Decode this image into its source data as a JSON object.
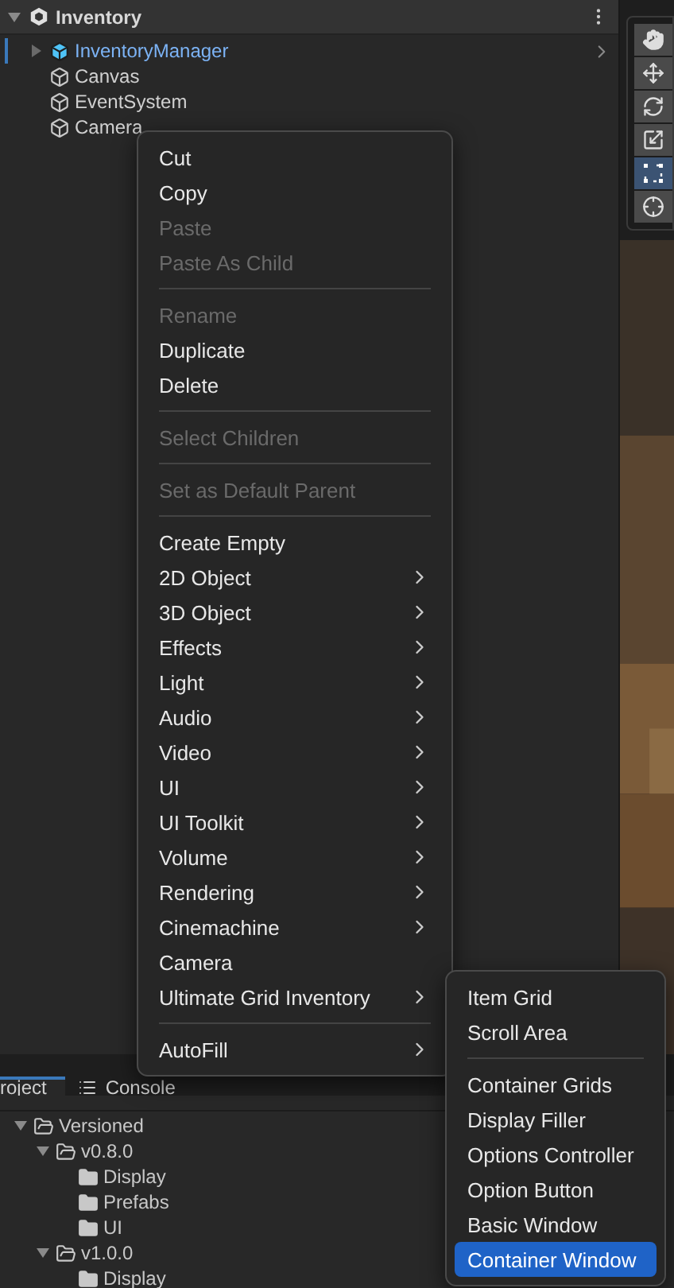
{
  "hierarchy": {
    "scene": "Inventory",
    "items": [
      {
        "label": "InventoryManager",
        "kind": "prefab",
        "selected": true,
        "expanded": false
      },
      {
        "label": "Canvas",
        "kind": "object",
        "selected": false
      },
      {
        "label": "EventSystem",
        "kind": "object",
        "selected": false
      },
      {
        "label": "Camera",
        "kind": "object",
        "selected": false
      }
    ]
  },
  "scene_tools": [
    {
      "kind": "hand",
      "selected": false
    },
    {
      "kind": "move",
      "selected": false
    },
    {
      "kind": "rotate",
      "selected": false
    },
    {
      "kind": "scale",
      "selected": false
    },
    {
      "kind": "rect",
      "selected": true
    },
    {
      "kind": "transform",
      "selected": false
    }
  ],
  "context_menu": {
    "items": [
      {
        "kind": "item",
        "label": "Cut",
        "disabled": false
      },
      {
        "kind": "item",
        "label": "Copy",
        "disabled": false
      },
      {
        "kind": "item",
        "label": "Paste",
        "disabled": true
      },
      {
        "kind": "item",
        "label": "Paste As Child",
        "disabled": true
      },
      {
        "kind": "separator"
      },
      {
        "kind": "item",
        "label": "Rename",
        "disabled": true
      },
      {
        "kind": "item",
        "label": "Duplicate",
        "disabled": false
      },
      {
        "kind": "item",
        "label": "Delete",
        "disabled": false
      },
      {
        "kind": "separator"
      },
      {
        "kind": "item",
        "label": "Select Children",
        "disabled": true
      },
      {
        "kind": "separator"
      },
      {
        "kind": "item",
        "label": "Set as Default Parent",
        "disabled": true
      },
      {
        "kind": "separator"
      },
      {
        "kind": "item",
        "label": "Create Empty",
        "disabled": false
      },
      {
        "kind": "submenu",
        "label": "2D Object",
        "disabled": false
      },
      {
        "kind": "submenu",
        "label": "3D Object",
        "disabled": false
      },
      {
        "kind": "submenu",
        "label": "Effects",
        "disabled": false
      },
      {
        "kind": "submenu",
        "label": "Light",
        "disabled": false
      },
      {
        "kind": "submenu",
        "label": "Audio",
        "disabled": false
      },
      {
        "kind": "submenu",
        "label": "Video",
        "disabled": false
      },
      {
        "kind": "submenu",
        "label": "UI",
        "disabled": false
      },
      {
        "kind": "submenu",
        "label": "UI Toolkit",
        "disabled": false
      },
      {
        "kind": "submenu",
        "label": "Volume",
        "disabled": false
      },
      {
        "kind": "submenu",
        "label": "Rendering",
        "disabled": false
      },
      {
        "kind": "submenu",
        "label": "Cinemachine",
        "disabled": false
      },
      {
        "kind": "item",
        "label": "Camera",
        "disabled": false
      },
      {
        "kind": "submenu",
        "label": "Ultimate Grid Inventory",
        "disabled": false
      },
      {
        "kind": "separator"
      },
      {
        "kind": "submenu",
        "label": "AutoFill",
        "disabled": false
      }
    ]
  },
  "submenu": {
    "items": [
      {
        "kind": "item",
        "label": "Item Grid",
        "selected": false
      },
      {
        "kind": "item",
        "label": "Scroll Area",
        "selected": false
      },
      {
        "kind": "separator"
      },
      {
        "kind": "item",
        "label": "Container Grids",
        "selected": false
      },
      {
        "kind": "item",
        "label": "Display Filler",
        "selected": false
      },
      {
        "kind": "item",
        "label": "Options Controller",
        "selected": false
      },
      {
        "kind": "item",
        "label": "Option Button",
        "selected": false
      },
      {
        "kind": "item",
        "label": "Basic Window",
        "selected": false
      },
      {
        "kind": "item",
        "label": "Container Window",
        "selected": true
      }
    ]
  },
  "project": {
    "tabs": [
      {
        "label": "roject",
        "selected": true
      },
      {
        "label": "Console",
        "selected": false
      }
    ],
    "tree": [
      {
        "label": "Versioned",
        "expanded": true,
        "children": [
          {
            "label": "v0.8.0",
            "expanded": true,
            "children": [
              {
                "label": "Display"
              },
              {
                "label": "Prefabs"
              },
              {
                "label": "UI"
              }
            ]
          },
          {
            "label": "v1.0.0",
            "expanded": true,
            "children": [
              {
                "label": "Display"
              }
            ]
          }
        ]
      }
    ]
  }
}
